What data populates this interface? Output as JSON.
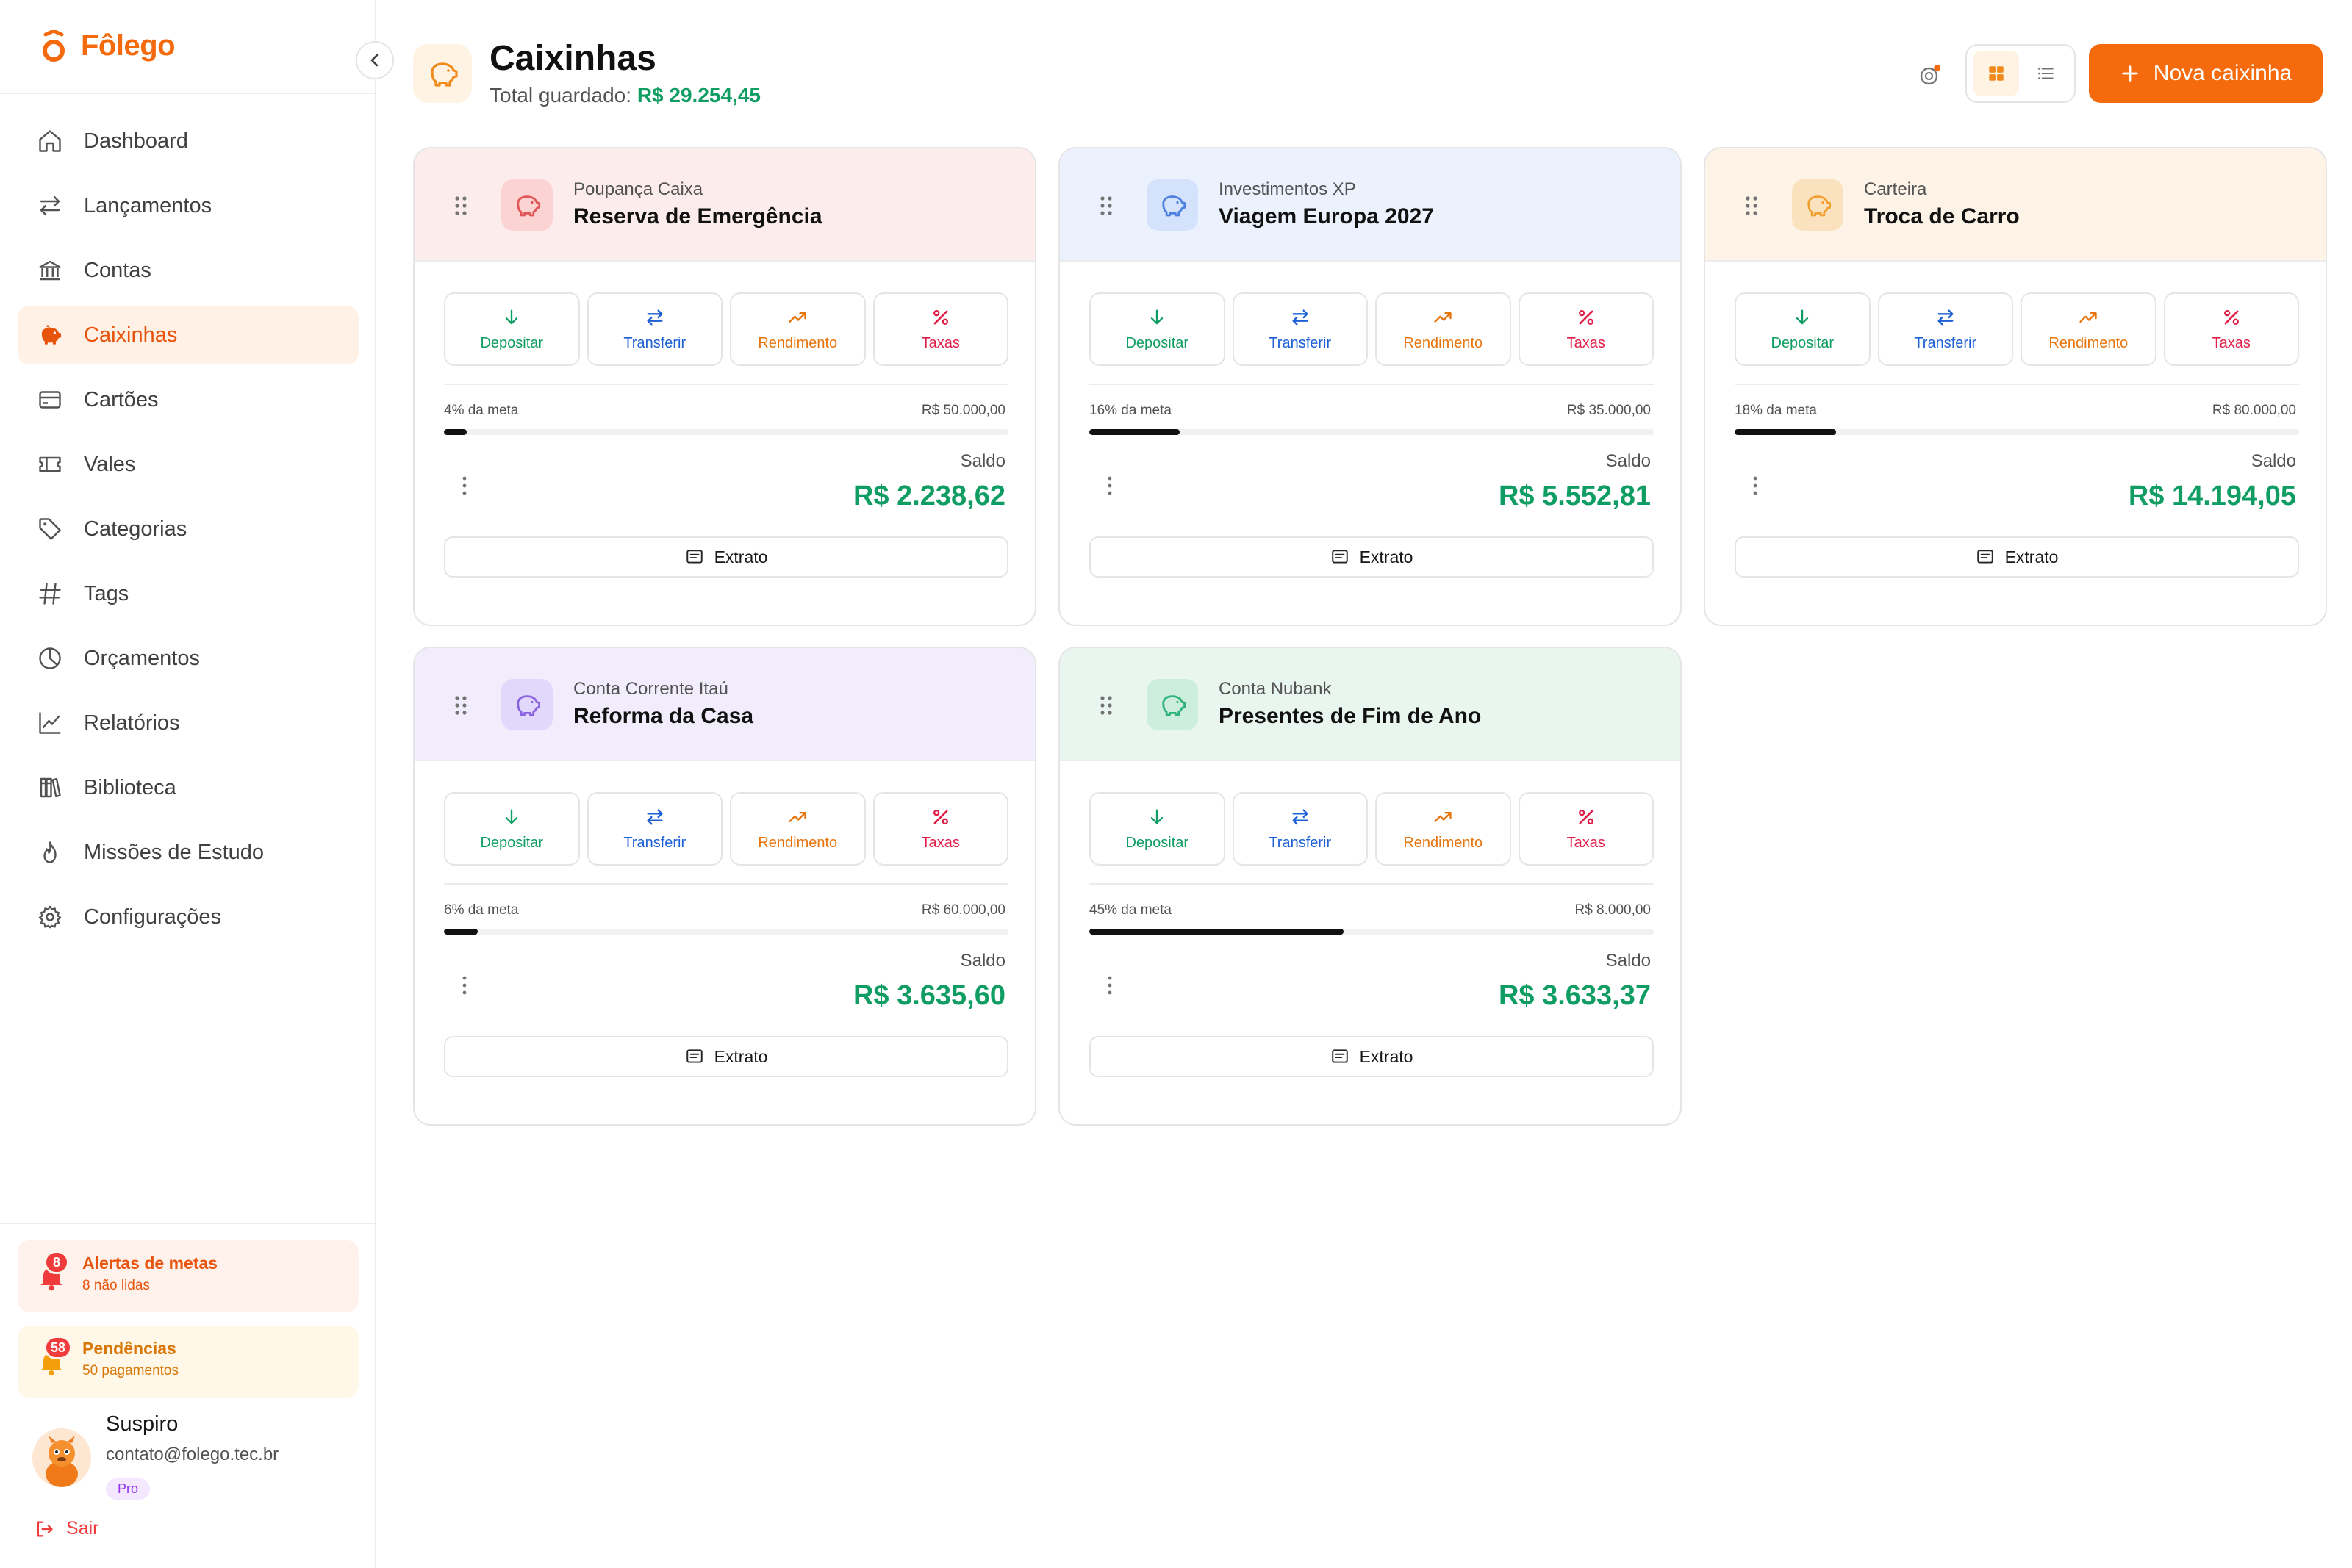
{
  "app": {
    "name": "Fôlego"
  },
  "sidebar": {
    "items": [
      {
        "label": "Dashboard",
        "icon": "home-icon"
      },
      {
        "label": "Lançamentos",
        "icon": "arrows-icon"
      },
      {
        "label": "Contas",
        "icon": "bank-icon"
      },
      {
        "label": "Caixinhas",
        "icon": "piggy-bank-icon",
        "active": true
      },
      {
        "label": "Cartões",
        "icon": "card-icon"
      },
      {
        "label": "Vales",
        "icon": "ticket-icon"
      },
      {
        "label": "Categorias",
        "icon": "tag-icon"
      },
      {
        "label": "Tags",
        "icon": "hash-icon"
      },
      {
        "label": "Orçamentos",
        "icon": "pie-icon"
      },
      {
        "label": "Relatórios",
        "icon": "chart-icon"
      },
      {
        "label": "Biblioteca",
        "icon": "books-icon"
      },
      {
        "label": "Missões de Estudo",
        "icon": "flame-icon"
      },
      {
        "label": "Configurações",
        "icon": "gear-icon"
      }
    ],
    "alerts": {
      "metas": {
        "title": "Alertas de metas",
        "subtitle": "8 não lidas",
        "count": "8"
      },
      "pendencias": {
        "title": "Pendências",
        "subtitle": "50 pagamentos",
        "count": "58"
      }
    },
    "user": {
      "name": "Suspiro",
      "email": "contato@folego.tec.br",
      "plan": "Pro"
    },
    "logout": "Sair"
  },
  "header": {
    "title": "Caixinhas",
    "subtitle_prefix": "Total guardado:",
    "total": "R$ 29.254,45",
    "new_button": "Nova caixinha"
  },
  "actions": {
    "deposit": "Depositar",
    "transfer": "Transferir",
    "yield": "Rendimento",
    "fees": "Taxas"
  },
  "labels": {
    "saldo": "Saldo",
    "extrato": "Extrato"
  },
  "boxes": [
    {
      "account": "Poupança Caixa",
      "name": "Reserva de Emergência",
      "pct_label": "4% da meta",
      "progress": 0.04,
      "goal": "R$ 50.000,00",
      "balance": "R$ 2.238,62",
      "theme": "#fdecec",
      "icon_bg": "#fbd3d3",
      "icon_color": "#e25555"
    },
    {
      "account": "Investimentos XP",
      "name": "Viagem Europa 2027",
      "pct_label": "16% da meta",
      "progress": 0.16,
      "goal": "R$ 35.000,00",
      "balance": "R$ 5.552,81",
      "theme": "#ebf1fd",
      "icon_bg": "#d5e2fb",
      "icon_color": "#4b7fe0"
    },
    {
      "account": "Carteira",
      "name": "Troca de Carro",
      "pct_label": "18% da meta",
      "progress": 0.18,
      "goal": "R$ 80.000,00",
      "balance": "R$ 14.194,05",
      "theme": "#fdf3e6",
      "icon_bg": "#fbe2bf",
      "icon_color": "#f0a030"
    },
    {
      "account": "Conta Corrente Itaú",
      "name": "Reforma da Casa",
      "pct_label": "6% da meta",
      "progress": 0.06,
      "goal": "R$ 60.000,00",
      "balance": "R$ 3.635,60",
      "theme": "#f1edfc",
      "icon_bg": "#e2d8fb",
      "icon_color": "#8a63e0"
    },
    {
      "account": "Conta Nubank",
      "name": "Presentes de Fim de Ano",
      "pct_label": "45% da meta",
      "progress": 0.45,
      "goal": "R$ 8.000,00",
      "balance": "R$ 3.633,37",
      "theme": "#e9f6ef",
      "icon_bg": "#cdeedd",
      "icon_color": "#2fb27a"
    }
  ],
  "colors": {
    "brand": "#f46a0c",
    "positive": "#0f9d63"
  }
}
